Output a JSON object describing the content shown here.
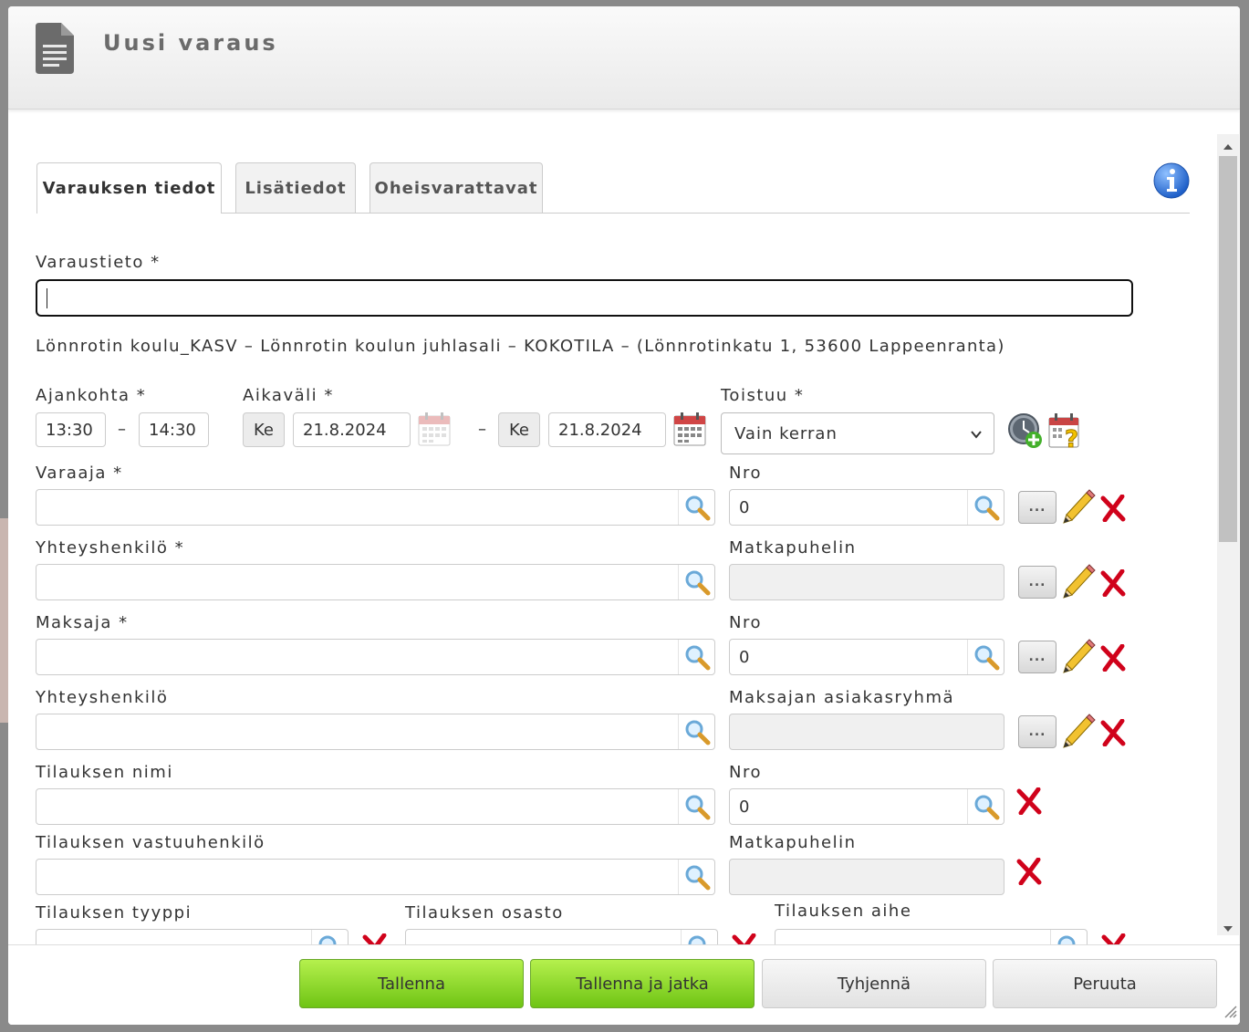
{
  "dialog": {
    "title": "Uusi varaus"
  },
  "tabs": [
    {
      "label": "Varauksen tiedot",
      "active": true
    },
    {
      "label": "Lisätiedot",
      "active": false
    },
    {
      "label": "Oheisvarattavat",
      "active": false
    }
  ],
  "form": {
    "varaustieto": {
      "label": "Varaustieto *",
      "value": ""
    },
    "location": "Lönnrotin koulu_KASV – Lönnrotin koulun juhlasali – KOKOTILA – (Lönnrotinkatu 1, 53600 Lappeenranta)",
    "ajankohta": {
      "label": "Ajankohta *",
      "start": "13:30",
      "separator": "–",
      "end": "14:30"
    },
    "aikavali": {
      "label": "Aikaväli *",
      "start_day": "Ke",
      "start_date": "21.8.2024",
      "separator": "–",
      "end_day": "Ke",
      "end_date": "21.8.2024"
    },
    "toistuu": {
      "label": "Toistuu *",
      "value": "Vain kerran"
    },
    "varaaja": {
      "label": "Varaaja *",
      "value": ""
    },
    "varaaja_nro": {
      "label": "Nro",
      "value": "0"
    },
    "yhteyshenkilo": {
      "label": "Yhteyshenkilö *",
      "value": ""
    },
    "matkapuhelin": {
      "label": "Matkapuhelin",
      "value": ""
    },
    "maksaja": {
      "label": "Maksaja *",
      "value": ""
    },
    "maksaja_nro": {
      "label": "Nro",
      "value": "0"
    },
    "maksajan_yhteyshenkilo": {
      "label": "Yhteyshenkilö",
      "value": ""
    },
    "maksajan_asiakasryhma": {
      "label": "Maksajan asiakasryhmä",
      "value": ""
    },
    "tilauksen_nimi": {
      "label": "Tilauksen nimi",
      "value": ""
    },
    "tilaus_nro": {
      "label": "Nro",
      "value": "0"
    },
    "tilauksen_vastuuhenkilo": {
      "label": "Tilauksen vastuuhenkilö",
      "value": ""
    },
    "vastuuhenkilo_matkapuhelin": {
      "label": "Matkapuhelin",
      "value": ""
    },
    "tilauksen_tyyppi": {
      "label": "Tilauksen tyyppi"
    },
    "tilauksen_osasto": {
      "label": "Tilauksen osasto"
    },
    "tilauksen_aihe": {
      "label": "Tilauksen aihe"
    },
    "dots_label": "..."
  },
  "footer": {
    "save": "Tallenna",
    "save_continue": "Tallenna ja jatka",
    "clear": "Tyhjennä",
    "cancel": "Peruuta"
  },
  "colors": {
    "save_button": "#8fdc2e",
    "delete_x": "#d0021b",
    "info": "#2a6fd6"
  }
}
